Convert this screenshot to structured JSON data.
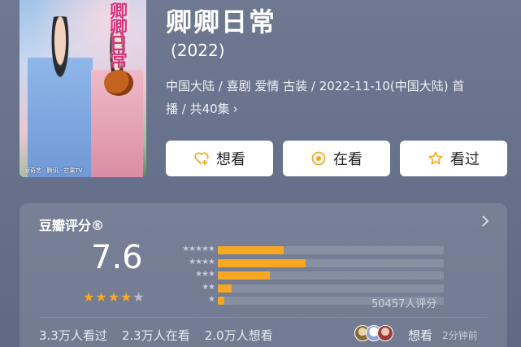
{
  "show": {
    "title": "卿卿日常",
    "year": "(2022)",
    "meta_line1": "中国大陆 / 喜剧 爱情 古装 / 2022-11-10(中国大陆) 首",
    "meta_line2": "播 / 共40集",
    "meta_chevron": "›"
  },
  "poster": {
    "title_text": "卿卿日常",
    "logos_text": "爱奇艺 · 腾讯 · 芒果TV"
  },
  "actions": {
    "want_label": "想看",
    "watching_label": "在看",
    "watched_label": "看过"
  },
  "rating": {
    "header": "豆瓣评分®",
    "score": "7.6",
    "stars": {
      "on": "★★★★",
      "off": "★"
    },
    "star_count": 3.8,
    "distribution": [
      {
        "label": "★★★★★",
        "fraction": 0.29
      },
      {
        "label": "★★★★",
        "fraction": 0.39
      },
      {
        "label": "★★★",
        "fraction": 0.23
      },
      {
        "label": "★★",
        "fraction": 0.06
      },
      {
        "label": "★",
        "fraction": 0.03
      }
    ],
    "rater_count": "50457人评分",
    "watched": "3.3万人看过",
    "watching": "2.3万人在看",
    "want_count": "2.0万人想看",
    "recent_action": "想看",
    "recent_time": "2分钟前"
  },
  "colors": {
    "accent": "#f6a822",
    "background": "#6a738d"
  },
  "icons": {
    "want": "heart-plus-icon",
    "watching": "target-icon",
    "watched": "star-outline-icon",
    "chevron": "chevron-right-icon"
  }
}
